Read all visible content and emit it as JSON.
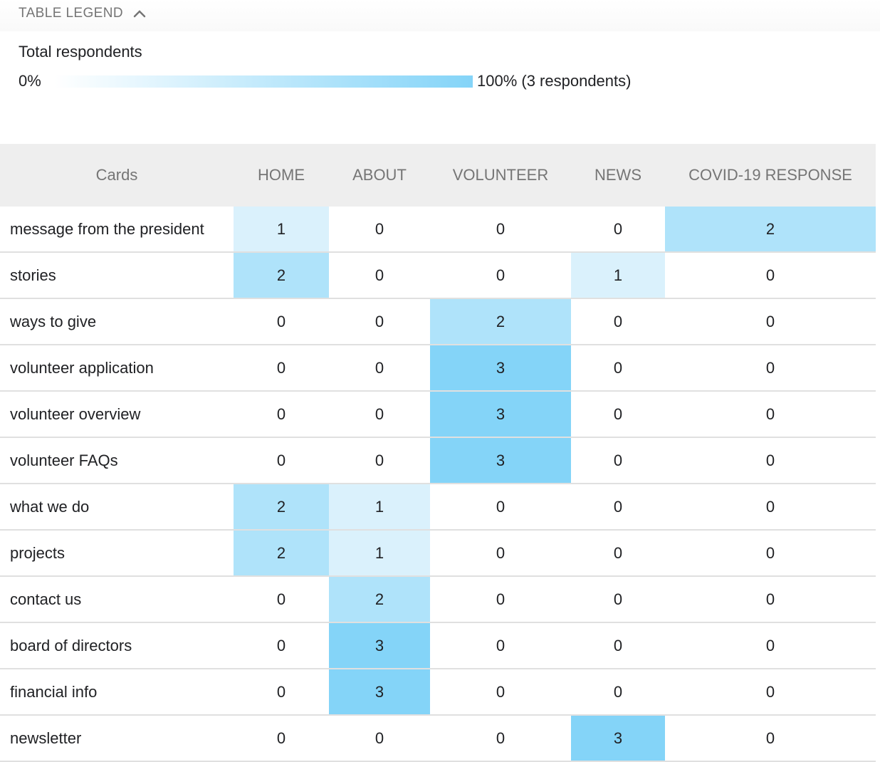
{
  "legend": {
    "title": "TABLE LEGEND",
    "subtitle": "Total respondents",
    "scale_min": "0%",
    "scale_max": "100% (3 respondents)",
    "toggle_icon": "chevron-up-icon",
    "colors": {
      "level_0": "#ffffff",
      "level_1": "#daf1fc",
      "level_2": "#afe3fa",
      "level_3": "#84d4f8"
    },
    "max_respondents": 3
  },
  "table": {
    "columns": [
      "Cards",
      "HOME",
      "ABOUT",
      "VOLUNTEER",
      "NEWS",
      "COVID-19 RESPONSE"
    ],
    "rows": [
      {
        "card": "message from the president",
        "values": [
          "1",
          "0",
          "0",
          "0",
          "2"
        ]
      },
      {
        "card": "stories",
        "values": [
          "2",
          "0",
          "0",
          "1",
          "0"
        ]
      },
      {
        "card": "ways to give",
        "values": [
          "0",
          "0",
          "2",
          "0",
          "0"
        ]
      },
      {
        "card": "volunteer application",
        "values": [
          "0",
          "0",
          "3",
          "0",
          "0"
        ]
      },
      {
        "card": "volunteer overview",
        "values": [
          "0",
          "0",
          "3",
          "0",
          "0"
        ]
      },
      {
        "card": "volunteer FAQs",
        "values": [
          "0",
          "0",
          "3",
          "0",
          "0"
        ]
      },
      {
        "card": "what we do",
        "values": [
          "2",
          "1",
          "0",
          "0",
          "0"
        ]
      },
      {
        "card": "projects",
        "values": [
          "2",
          "1",
          "0",
          "0",
          "0"
        ]
      },
      {
        "card": "contact us",
        "values": [
          "0",
          "2",
          "0",
          "0",
          "0"
        ]
      },
      {
        "card": "board of directors",
        "values": [
          "0",
          "3",
          "0",
          "0",
          "0"
        ]
      },
      {
        "card": "financial info",
        "values": [
          "0",
          "3",
          "0",
          "0",
          "0"
        ]
      },
      {
        "card": "newsletter",
        "values": [
          "0",
          "0",
          "0",
          "3",
          "0"
        ]
      }
    ]
  }
}
